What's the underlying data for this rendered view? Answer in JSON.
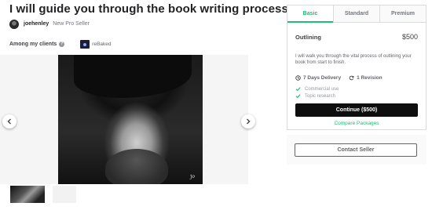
{
  "gig": {
    "title": "I will guide you through the book writing process",
    "seller_name": "joehenley",
    "seller_level": "New Pro Seller",
    "clients_label": "Among my clients",
    "client_name": "reBaked"
  },
  "gallery": {
    "signature_text": "Jo"
  },
  "packages": {
    "tabs": [
      "Basic",
      "Standard",
      "Premium"
    ],
    "active_tab": "Basic",
    "name": "Outlining",
    "price": "$500",
    "description": "I will walk you through the vital process of outlining your book from start to finish.",
    "delivery": "7 Days Delivery",
    "revisions": "1 Revision",
    "features": [
      "Commercial use",
      "Topic research"
    ],
    "continue_label": "Continue ($500)",
    "compare_label": "Compare Packages"
  },
  "contact": {
    "button_label": "Contact Seller"
  },
  "colors": {
    "accent": "#1dbf73",
    "primary_button": "#0e0e0f"
  },
  "icons": {
    "help": "help-icon",
    "prev": "chevron-left-icon",
    "next": "chevron-right-icon",
    "delivery": "clock-icon",
    "revisions": "refresh-icon",
    "check": "check-icon"
  }
}
